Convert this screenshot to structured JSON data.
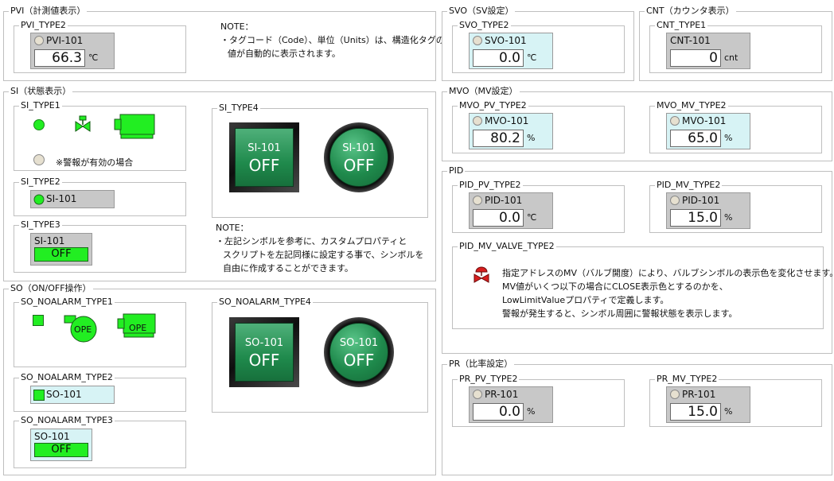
{
  "pvi": {
    "group_label": "PVI（計測値表示）",
    "type2": {
      "label": "PVI_TYPE2",
      "tag": "PVI-101",
      "value": "66.3",
      "unit": "℃"
    },
    "note": [
      "NOTE：",
      "・タグコード（Code）、単位（Units）は、構造化タグの",
      "値が自動的に表示されます。"
    ]
  },
  "svo": {
    "group_label": "SVO（SV設定）",
    "type2": {
      "label": "SVO_TYPE2",
      "tag": "SVO-101",
      "value": "0.0",
      "unit": "℃"
    }
  },
  "cnt": {
    "group_label": "CNT（カウンタ表示）",
    "type1": {
      "label": "CNT_TYPE1",
      "tag": "CNT-101",
      "value": "0",
      "unit": "cnt"
    }
  },
  "si": {
    "group_label": "SI（状態表示）",
    "type1": {
      "label": "SI_TYPE1",
      "alarm_note": "※警報が有効の場合"
    },
    "type2": {
      "label": "SI_TYPE2",
      "tag": "SI-101"
    },
    "type3": {
      "label": "SI_TYPE3",
      "tag": "SI-101",
      "status": "OFF"
    },
    "type4": {
      "label": "SI_TYPE4",
      "square_tag": "SI-101",
      "square_status": "OFF",
      "round_tag": "SI-101",
      "round_status": "OFF"
    },
    "note": [
      "NOTE：",
      "・左記シンボルを参考に、カスタムプロパティと",
      "スクリプトを左記同様に設定する事で、シンボルを",
      "自由に作成することができます。"
    ]
  },
  "so": {
    "group_label": "SO（ON/OFF操作）",
    "type1": {
      "label": "SO_NOALARM_TYPE1",
      "pump_label": "OPE",
      "motor_label": "OPE"
    },
    "type2": {
      "label": "SO_NOALARM_TYPE2",
      "tag": "SO-101"
    },
    "type3": {
      "label": "SO_NOALARM_TYPE3",
      "tag": "SO-101",
      "status": "OFF"
    },
    "type4": {
      "label": "SO_NOALARM_TYPE4",
      "square_tag": "SO-101",
      "square_status": "OFF",
      "round_tag": "SO-101",
      "round_status": "OFF"
    }
  },
  "mvo": {
    "group_label": "MVO（MV設定）",
    "pv": {
      "label": "MVO_PV_TYPE2",
      "tag": "MVO-101",
      "value": "80.2",
      "unit": "%"
    },
    "mv": {
      "label": "MVO_MV_TYPE2",
      "tag": "MVO-101",
      "value": "65.0",
      "unit": "%"
    }
  },
  "pid": {
    "group_label": "PID",
    "pv": {
      "label": "PID_PV_TYPE2",
      "tag": "PID-101",
      "value": "0.0",
      "unit": "℃"
    },
    "mv": {
      "label": "PID_MV_TYPE2",
      "tag": "PID-101",
      "value": "15.0",
      "unit": "%"
    },
    "valve": {
      "label": "PID_MV_VALVE_TYPE2",
      "note": [
        "指定アドレスのMV（バルブ開度）により、バルブシンボルの表示色を変化させます。",
        "MV値がいくつ以下の場合にCLOSE表示色とするのかを、",
        "LowLimitValueプロパティで定義します。",
        "警報が発生すると、シンボル周囲に警報状態を表示します。"
      ]
    }
  },
  "pr": {
    "group_label": "PR（比率設定）",
    "pv": {
      "label": "PR_PV_TYPE2",
      "tag": "PR-101",
      "value": "0.0",
      "unit": "%"
    },
    "mv": {
      "label": "PR_MV_TYPE2",
      "tag": "PR-101",
      "value": "15.0",
      "unit": "%"
    }
  },
  "colors": {
    "green": "#22ee22",
    "dark_green": "#1f8a4c",
    "cyan_panel": "#d7f3f5",
    "gray_panel": "#c8c8c8",
    "valve_red": "#d81e1e"
  },
  "icons": [
    "lamp-icon",
    "valve-icon",
    "motor-icon",
    "pump-icon",
    "control-valve-icon"
  ]
}
